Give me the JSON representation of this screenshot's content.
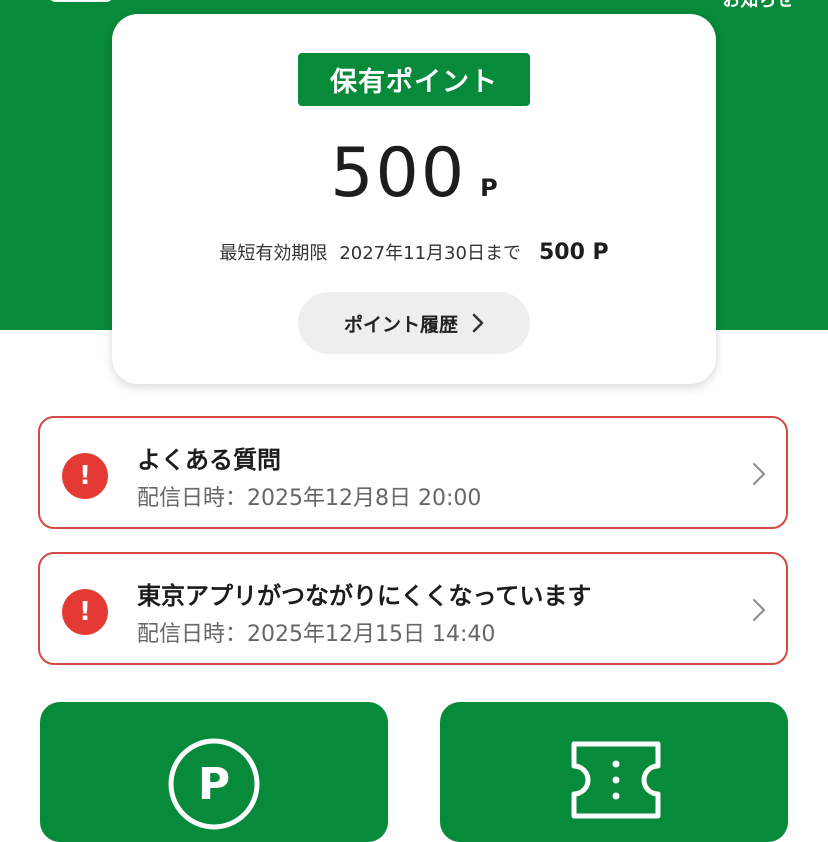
{
  "header": {
    "notice_label": "お知らせ"
  },
  "points_card": {
    "label": "保有ポイント",
    "balance": "500",
    "unit": "P",
    "expiry_label": "最短有効期限",
    "expiry_date": "2027年11月30日まで",
    "expiry_amount": "500 P",
    "history_button": "ポイント履歴"
  },
  "notices": [
    {
      "title": "よくある質問",
      "meta": "配信日時：2025年12月8日 20:00",
      "icon": "alert-icon"
    },
    {
      "title": "東京アプリがつながりにくくなっています",
      "meta": "配信日時：2025年12月15日 14:40",
      "icon": "alert-icon"
    }
  ],
  "tiles": [
    {
      "icon": "points-circle-icon"
    },
    {
      "icon": "ticket-icon"
    }
  ],
  "colors": {
    "brand_green": "#088a3b",
    "alert_red": "#e53935",
    "alert_border": "#d44a41"
  }
}
